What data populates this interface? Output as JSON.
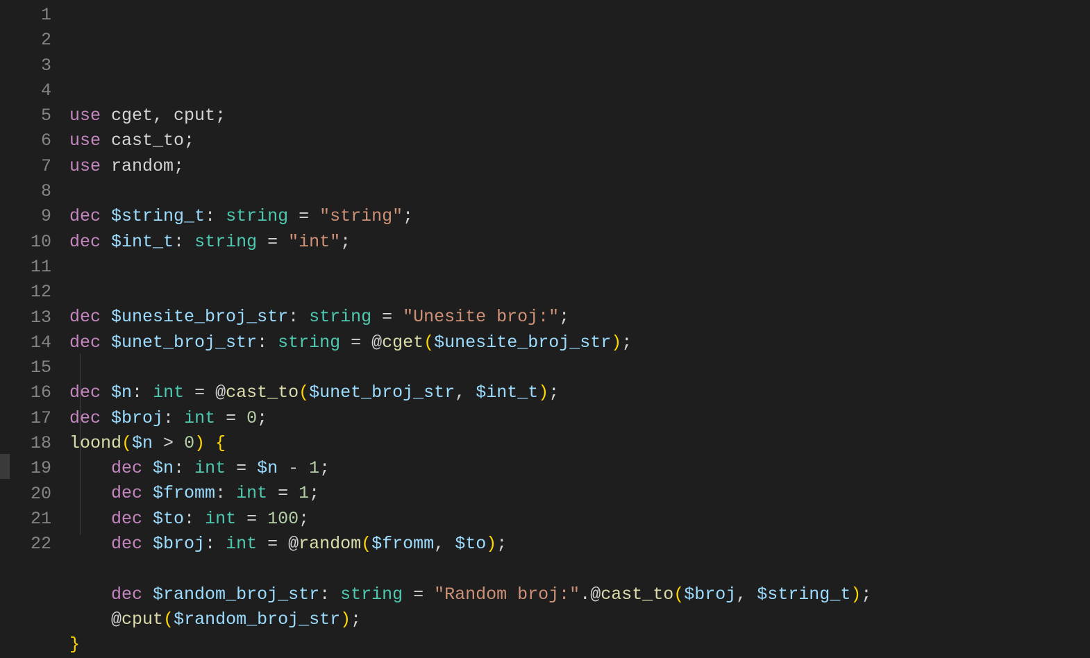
{
  "lines": [
    {
      "n": "1",
      "tokens": [
        {
          "c": "kw",
          "t": "use"
        },
        {
          "c": "plain",
          "t": " cget"
        },
        {
          "c": "punc",
          "t": ", "
        },
        {
          "c": "plain",
          "t": "cput"
        },
        {
          "c": "punc",
          "t": ";"
        }
      ]
    },
    {
      "n": "2",
      "tokens": [
        {
          "c": "kw",
          "t": "use"
        },
        {
          "c": "plain",
          "t": " cast_to"
        },
        {
          "c": "punc",
          "t": ";"
        }
      ]
    },
    {
      "n": "3",
      "tokens": [
        {
          "c": "kw",
          "t": "use"
        },
        {
          "c": "plain",
          "t": " random"
        },
        {
          "c": "punc",
          "t": ";"
        }
      ]
    },
    {
      "n": "4",
      "tokens": []
    },
    {
      "n": "5",
      "tokens": [
        {
          "c": "kw",
          "t": "dec"
        },
        {
          "c": "plain",
          "t": " "
        },
        {
          "c": "var",
          "t": "$string_t"
        },
        {
          "c": "punc",
          "t": ": "
        },
        {
          "c": "type",
          "t": "string"
        },
        {
          "c": "op",
          "t": " = "
        },
        {
          "c": "str",
          "t": "\"string\""
        },
        {
          "c": "punc",
          "t": ";"
        }
      ]
    },
    {
      "n": "6",
      "tokens": [
        {
          "c": "kw",
          "t": "dec"
        },
        {
          "c": "plain",
          "t": " "
        },
        {
          "c": "var",
          "t": "$int_t"
        },
        {
          "c": "punc",
          "t": ": "
        },
        {
          "c": "type",
          "t": "string"
        },
        {
          "c": "op",
          "t": " = "
        },
        {
          "c": "str",
          "t": "\"int\""
        },
        {
          "c": "punc",
          "t": ";"
        }
      ]
    },
    {
      "n": "7",
      "tokens": []
    },
    {
      "n": "8",
      "tokens": []
    },
    {
      "n": "9",
      "tokens": [
        {
          "c": "kw",
          "t": "dec"
        },
        {
          "c": "plain",
          "t": " "
        },
        {
          "c": "var",
          "t": "$unesite_broj_str"
        },
        {
          "c": "punc",
          "t": ": "
        },
        {
          "c": "type",
          "t": "string"
        },
        {
          "c": "op",
          "t": " = "
        },
        {
          "c": "str",
          "t": "\"Unesite broj:\""
        },
        {
          "c": "punc",
          "t": ";"
        }
      ]
    },
    {
      "n": "10",
      "tokens": [
        {
          "c": "kw",
          "t": "dec"
        },
        {
          "c": "plain",
          "t": " "
        },
        {
          "c": "var",
          "t": "$unet_broj_str"
        },
        {
          "c": "punc",
          "t": ": "
        },
        {
          "c": "type",
          "t": "string"
        },
        {
          "c": "op",
          "t": " = "
        },
        {
          "c": "at",
          "t": "@"
        },
        {
          "c": "fn",
          "t": "cget"
        },
        {
          "c": "curly",
          "t": "("
        },
        {
          "c": "var",
          "t": "$unesite_broj_str"
        },
        {
          "c": "curly",
          "t": ")"
        },
        {
          "c": "punc",
          "t": ";"
        }
      ]
    },
    {
      "n": "11",
      "tokens": []
    },
    {
      "n": "12",
      "tokens": [
        {
          "c": "kw",
          "t": "dec"
        },
        {
          "c": "plain",
          "t": " "
        },
        {
          "c": "var",
          "t": "$n"
        },
        {
          "c": "punc",
          "t": ": "
        },
        {
          "c": "type",
          "t": "int"
        },
        {
          "c": "op",
          "t": " = "
        },
        {
          "c": "at",
          "t": "@"
        },
        {
          "c": "fn",
          "t": "cast_to"
        },
        {
          "c": "curly",
          "t": "("
        },
        {
          "c": "var",
          "t": "$unet_broj_str"
        },
        {
          "c": "punc",
          "t": ", "
        },
        {
          "c": "var",
          "t": "$int_t"
        },
        {
          "c": "curly",
          "t": ")"
        },
        {
          "c": "punc",
          "t": ";"
        }
      ]
    },
    {
      "n": "13",
      "tokens": [
        {
          "c": "kw",
          "t": "dec"
        },
        {
          "c": "plain",
          "t": " "
        },
        {
          "c": "var",
          "t": "$broj"
        },
        {
          "c": "punc",
          "t": ": "
        },
        {
          "c": "type",
          "t": "int"
        },
        {
          "c": "op",
          "t": " = "
        },
        {
          "c": "num",
          "t": "0"
        },
        {
          "c": "punc",
          "t": ";"
        }
      ]
    },
    {
      "n": "14",
      "tokens": [
        {
          "c": "fn",
          "t": "loond"
        },
        {
          "c": "curly",
          "t": "("
        },
        {
          "c": "var",
          "t": "$n"
        },
        {
          "c": "op",
          "t": " > "
        },
        {
          "c": "num",
          "t": "0"
        },
        {
          "c": "curly",
          "t": ")"
        },
        {
          "c": "plain",
          "t": " "
        },
        {
          "c": "curly",
          "t": "{"
        }
      ]
    },
    {
      "n": "15",
      "tokens": [
        {
          "c": "plain",
          "t": "    "
        },
        {
          "c": "kw",
          "t": "dec"
        },
        {
          "c": "plain",
          "t": " "
        },
        {
          "c": "var",
          "t": "$n"
        },
        {
          "c": "punc",
          "t": ": "
        },
        {
          "c": "type",
          "t": "int"
        },
        {
          "c": "op",
          "t": " = "
        },
        {
          "c": "var",
          "t": "$n"
        },
        {
          "c": "op",
          "t": " - "
        },
        {
          "c": "num",
          "t": "1"
        },
        {
          "c": "punc",
          "t": ";"
        }
      ]
    },
    {
      "n": "16",
      "tokens": [
        {
          "c": "plain",
          "t": "    "
        },
        {
          "c": "kw",
          "t": "dec"
        },
        {
          "c": "plain",
          "t": " "
        },
        {
          "c": "var",
          "t": "$fromm"
        },
        {
          "c": "punc",
          "t": ": "
        },
        {
          "c": "type",
          "t": "int"
        },
        {
          "c": "op",
          "t": " = "
        },
        {
          "c": "num",
          "t": "1"
        },
        {
          "c": "punc",
          "t": ";"
        }
      ]
    },
    {
      "n": "17",
      "tokens": [
        {
          "c": "plain",
          "t": "    "
        },
        {
          "c": "kw",
          "t": "dec"
        },
        {
          "c": "plain",
          "t": " "
        },
        {
          "c": "var",
          "t": "$to"
        },
        {
          "c": "punc",
          "t": ": "
        },
        {
          "c": "type",
          "t": "int"
        },
        {
          "c": "op",
          "t": " = "
        },
        {
          "c": "num",
          "t": "100"
        },
        {
          "c": "punc",
          "t": ";"
        }
      ]
    },
    {
      "n": "18",
      "tokens": [
        {
          "c": "plain",
          "t": "    "
        },
        {
          "c": "kw",
          "t": "dec"
        },
        {
          "c": "plain",
          "t": " "
        },
        {
          "c": "var",
          "t": "$broj"
        },
        {
          "c": "punc",
          "t": ": "
        },
        {
          "c": "type",
          "t": "int"
        },
        {
          "c": "op",
          "t": " = "
        },
        {
          "c": "at",
          "t": "@"
        },
        {
          "c": "fn",
          "t": "random"
        },
        {
          "c": "curly",
          "t": "("
        },
        {
          "c": "var",
          "t": "$fromm"
        },
        {
          "c": "punc",
          "t": ", "
        },
        {
          "c": "var",
          "t": "$to"
        },
        {
          "c": "curly",
          "t": ")"
        },
        {
          "c": "punc",
          "t": ";"
        }
      ]
    },
    {
      "n": "19",
      "tokens": []
    },
    {
      "n": "20",
      "tokens": [
        {
          "c": "plain",
          "t": "    "
        },
        {
          "c": "kw",
          "t": "dec"
        },
        {
          "c": "plain",
          "t": " "
        },
        {
          "c": "var",
          "t": "$random_broj_str"
        },
        {
          "c": "punc",
          "t": ": "
        },
        {
          "c": "type",
          "t": "string"
        },
        {
          "c": "op",
          "t": " = "
        },
        {
          "c": "str",
          "t": "\"Random broj:\""
        },
        {
          "c": "punc",
          "t": "."
        },
        {
          "c": "at",
          "t": "@"
        },
        {
          "c": "fn",
          "t": "cast_to"
        },
        {
          "c": "curly",
          "t": "("
        },
        {
          "c": "var",
          "t": "$broj"
        },
        {
          "c": "punc",
          "t": ", "
        },
        {
          "c": "var",
          "t": "$string_t"
        },
        {
          "c": "curly",
          "t": ")"
        },
        {
          "c": "punc",
          "t": ";"
        }
      ]
    },
    {
      "n": "21",
      "tokens": [
        {
          "c": "plain",
          "t": "    "
        },
        {
          "c": "at",
          "t": "@"
        },
        {
          "c": "fn",
          "t": "cput"
        },
        {
          "c": "curly",
          "t": "("
        },
        {
          "c": "var",
          "t": "$random_broj_str"
        },
        {
          "c": "curly",
          "t": ")"
        },
        {
          "c": "punc",
          "t": ";"
        }
      ]
    },
    {
      "n": "22",
      "tokens": [
        {
          "c": "curly",
          "t": "}"
        }
      ]
    }
  ]
}
